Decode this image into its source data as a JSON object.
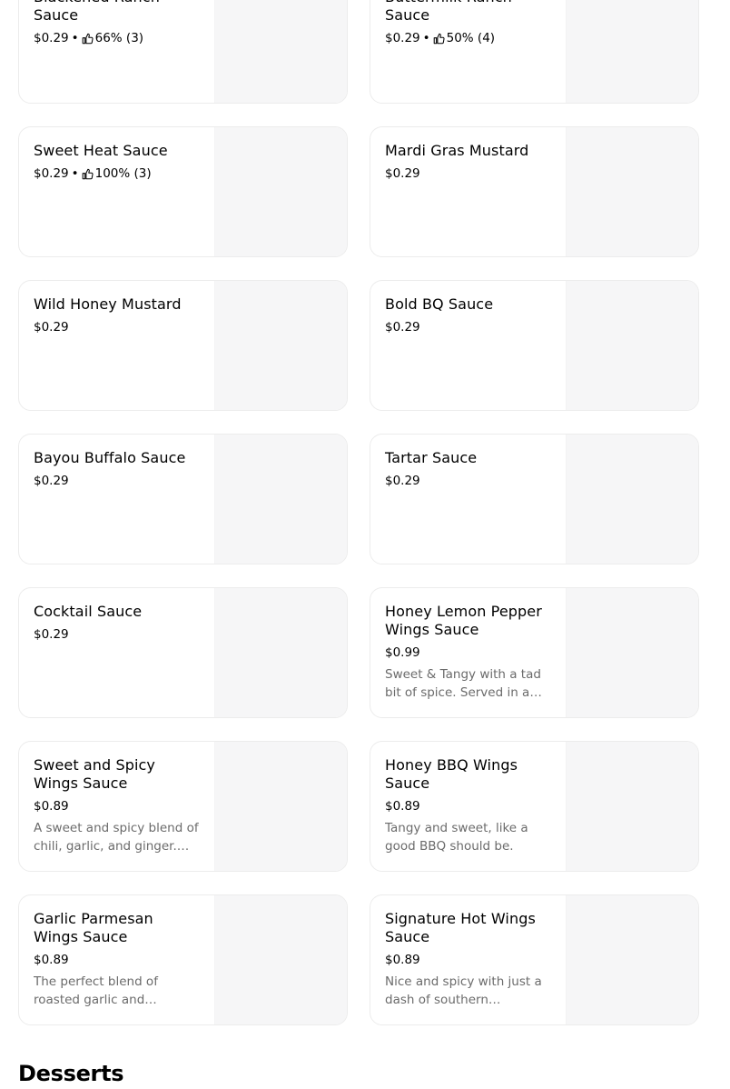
{
  "items": [
    {
      "name": "Blackened Ranch Sauce",
      "price": "$0.29",
      "rating": "66% (3)",
      "description": ""
    },
    {
      "name": "Buttermilk Ranch Sauce",
      "price": "$0.29",
      "rating": "50% (4)",
      "description": ""
    },
    {
      "name": "Sweet Heat Sauce",
      "price": "$0.29",
      "rating": "100% (3)",
      "description": ""
    },
    {
      "name": "Mardi Gras Mustard",
      "price": "$0.29",
      "rating": "",
      "description": ""
    },
    {
      "name": "Wild Honey Mustard",
      "price": "$0.29",
      "rating": "",
      "description": ""
    },
    {
      "name": "Bold BQ Sauce",
      "price": "$0.29",
      "rating": "",
      "description": ""
    },
    {
      "name": "Bayou Buffalo Sauce",
      "price": "$0.29",
      "rating": "",
      "description": ""
    },
    {
      "name": "Tartar Sauce",
      "price": "$0.29",
      "rating": "",
      "description": ""
    },
    {
      "name": "Cocktail Sauce",
      "price": "$0.29",
      "rating": "",
      "description": ""
    },
    {
      "name": "Honey Lemon Pepper Wings Sauce",
      "price": "$0.99",
      "rating": "",
      "description": "Sweet & Tangy with a tad bit of spice. Served in a soufflé cup."
    },
    {
      "name": "Sweet and Spicy Wings Sauce",
      "price": "$0.89",
      "rating": "",
      "description": "A sweet and spicy blend of chili, garlic, and ginger. Served in a soufflé cup."
    },
    {
      "name": "Honey BBQ Wings Sauce",
      "price": "$0.89",
      "rating": "",
      "description": "Tangy and sweet, like a good BBQ should be."
    },
    {
      "name": "Garlic Parmesan Wings Sauce",
      "price": "$0.89",
      "rating": "",
      "description": "The perfect blend of roasted garlic and parmesan cheese. Served in a soufflé cup."
    },
    {
      "name": "Signature Hot Wings Sauce",
      "price": "$0.89",
      "rating": "",
      "description": "Nice and spicy with just a dash of southern sweetness."
    }
  ],
  "next_section": {
    "title": "Desserts"
  },
  "icons": {
    "rating": "thumbs-up-icon"
  },
  "colors": {
    "card_border": "#ececec",
    "image_placeholder": "#f6f6f7",
    "description_text": "#6b6b6b"
  }
}
